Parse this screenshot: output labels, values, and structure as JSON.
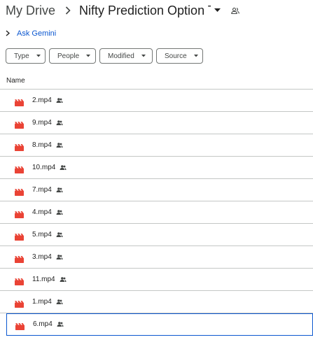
{
  "breadcrumb": {
    "root": "My Drive",
    "current": "Nifty Prediction Option T...",
    "separator_icon": "chevron-right-icon",
    "caret_icon": "caret-down-icon",
    "shared_icon": "people-icon"
  },
  "gemini": {
    "label": "Ask Gemini",
    "icon": "chevron-right-icon"
  },
  "filters": [
    {
      "label": "Type"
    },
    {
      "label": "People"
    },
    {
      "label": "Modified"
    },
    {
      "label": "Source"
    }
  ],
  "table": {
    "header_name": "Name"
  },
  "files": [
    {
      "name": "2.mp4",
      "shared": true
    },
    {
      "name": "9.mp4",
      "shared": true
    },
    {
      "name": "8.mp4",
      "shared": true
    },
    {
      "name": "10.mp4",
      "shared": true
    },
    {
      "name": "7.mp4",
      "shared": true
    },
    {
      "name": "4.mp4",
      "shared": true
    },
    {
      "name": "5.mp4",
      "shared": true
    },
    {
      "name": "3.mp4",
      "shared": true
    },
    {
      "name": "11.mp4",
      "shared": true
    },
    {
      "name": "1.mp4",
      "shared": true
    },
    {
      "name": "6.mp4",
      "shared": true,
      "selected": true
    }
  ],
  "colors": {
    "video_icon": "#ea4335",
    "link": "#0b57d0",
    "selected_border": "#0b57d0",
    "divider": "#c4c7c5"
  }
}
